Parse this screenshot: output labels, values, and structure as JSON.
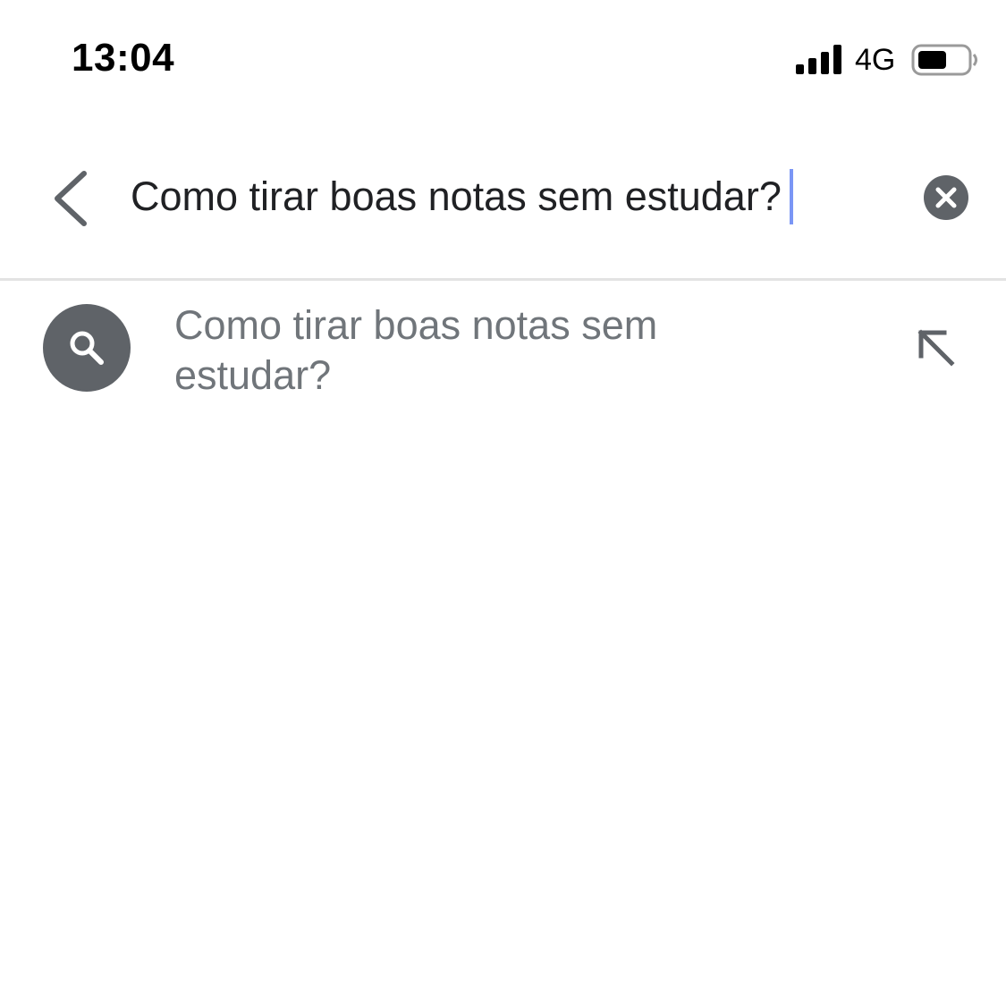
{
  "status_bar": {
    "time": "13:04",
    "network": "4G",
    "signal_icon": "cellular-signal-icon",
    "battery_icon": "battery-icon",
    "battery_level": 0.6
  },
  "search": {
    "value": "Como tirar boas notas sem estudar?",
    "back_icon": "chevron-left-icon",
    "clear_icon": "clear-circle-icon",
    "cursor_color": "#7b96f5"
  },
  "suggestions": [
    {
      "text": "Como tirar boas notas sem estudar?",
      "leading_icon": "search-icon",
      "trailing_icon": "arrow-up-left-icon"
    }
  ],
  "colors": {
    "icon_gray": "#5f6368",
    "suggestion_text": "#70757a",
    "query_text": "#202124",
    "divider": "#e3e3e3"
  }
}
